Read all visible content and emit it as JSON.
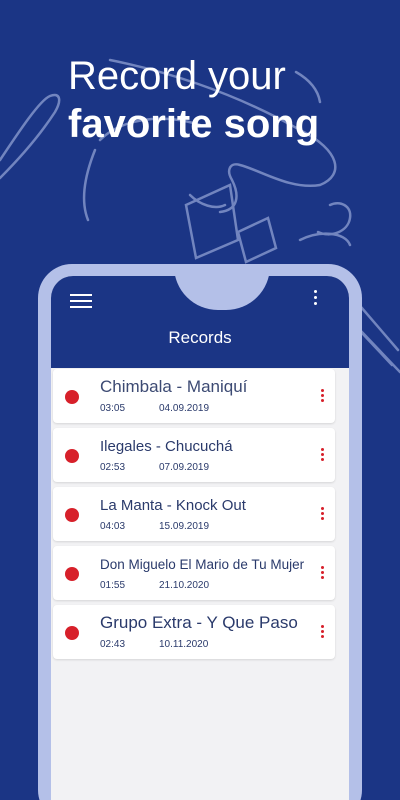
{
  "headline": {
    "line1": "Record your",
    "line2": "favorite song"
  },
  "app": {
    "title": "Records"
  },
  "colors": {
    "brand": "#1b3585",
    "frame": "#b4c0e8",
    "record": "#d7202a",
    "screen": "#f2f2f4"
  },
  "icons": {
    "menu": "hamburger-menu-icon",
    "more": "more-vert-icon",
    "record": "record-dot-icon",
    "item_menu": "item-more-icon"
  },
  "records": [
    {
      "name": "Chimbala - Maniquí",
      "duration": "03:05",
      "date": "04.09.2019"
    },
    {
      "name": "Ilegales - Chucuchá",
      "duration": "02:53",
      "date": "07.09.2019"
    },
    {
      "name": "La Manta - Knock Out",
      "duration": "04:03",
      "date": "15.09.2019"
    },
    {
      "name": "Don Miguelo El Mario de Tu Mujer",
      "duration": "01:55",
      "date": "21.10.2020"
    },
    {
      "name": "Grupo Extra - Y Que Paso",
      "duration": "02:43",
      "date": "10.11.2020"
    }
  ]
}
